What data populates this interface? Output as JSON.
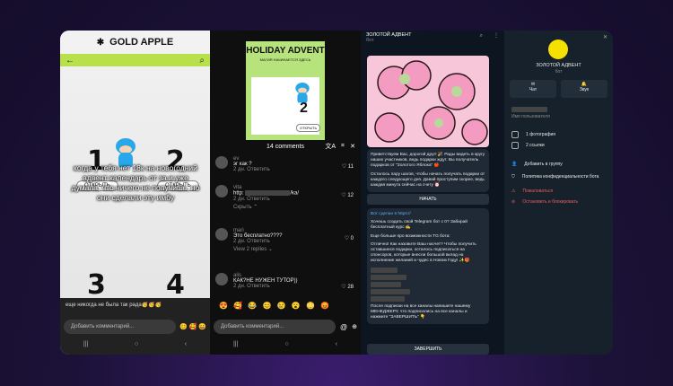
{
  "p1": {
    "brand": "GOLD APPLE",
    "numbers": [
      "1",
      "2",
      "3",
      "4"
    ],
    "open_label": "ОТКРЫТЬ",
    "caption": "когда у тебя нет 18к на новогодний адвент календарь от за и уже думала, что ничего не получишь, но они сделали эту имбу",
    "comment_line": "еще никогда не была так рада🥳🥳🥳",
    "input_placeholder": "Добавить комментарий...",
    "emoji": "😊 🥰 😄"
  },
  "p2": {
    "adv_title": "HOLIDAY ADVENT",
    "adv_sub": "МАГИЯ НАЧИНАЕТСЯ ЗДЕСЬ",
    "adv_num": "2",
    "adv_open": "ОТКРЫТЬ",
    "comments_count": "14 comments",
    "c1_user": "ev",
    "c1_text": "эг как ?",
    "c1_meta": "2 дн.   Ответить",
    "c1_likes": "11",
    "c2_user": "vita",
    "c2_text": "http:",
    "c2_text2": "/ka/",
    "c2_meta": "2 дн.   Ответить",
    "c2_likes": "12",
    "c2_hide": "Скрыть ⌃",
    "c3_user": "mari",
    "c3_text": "Это бесплатно????",
    "c3_meta": "2 дн.   Ответить",
    "c3_likes": "0",
    "c3_replies": "View 2 replies ⌄",
    "c4_user": "alis",
    "c4_text": "КАК?НЕ НУЖЕН ТУТОР))",
    "c4_meta": "2 дн.   Ответить",
    "c4_likes": "28",
    "emoji_row": "😍 🥰 😂 😊 😢 😮 😳 😡",
    "input_placeholder": "Добавить комментарий...",
    "at": "@"
  },
  "p3": {
    "title": "ЗОЛОТОЙ АДВЕНТ",
    "subtitle": "бот",
    "msg1": "Приветствуем Вас, дорогой друг! 🎉 Рады видеть в кругу наших участников, ведь подарки ждут. Вы получатель подарков от \"Золотого Яблока\" 🍎",
    "msg1b": "Осталось пару шагов, чтобы начать получать подарки от каждого следующего дня. Давай проступим скорее, ведь каждая минута сейчас на счету ⏰",
    "btn1": "НАЧАТЬ",
    "msg2a": "Вот сделан в https://",
    "msg2b": "Хочешь создать свой Telegram бот с 0? Забирай бесплатный курс ✍️",
    "msg2c": "Еще больше про возможности ТG бота:",
    "msg2d": "Отлично! Как назовите Ваш насчет? Чтобы получить оставшиеся подарки, осталось подписаться на спонсоров, которые внесли большой вклад на исполнение желаний и чудес в Новом Году! ✨🎁",
    "msg2e": "После подписки на все каналы напишите нашему МЕНЕДЖЕРУ, что подписались на все каналы и нажмите \"ЗАВЕРШИТЬ\" 👇",
    "btn2": "ЗАВЕРШИТЬ"
  },
  "p4": {
    "name": "ЗОЛОТОЙ АДВЕНТ",
    "sub": "бот",
    "chat": "Чат",
    "sound": "Звук",
    "user_hint": "Имя пользователя",
    "photos": "1 фотография",
    "links": "2 ссылки",
    "add_group": "Добавить в группу",
    "privacy": "Политика конфиденциальности бота",
    "report": "Пожаловаться",
    "stop": "Остановить и блокировать"
  }
}
